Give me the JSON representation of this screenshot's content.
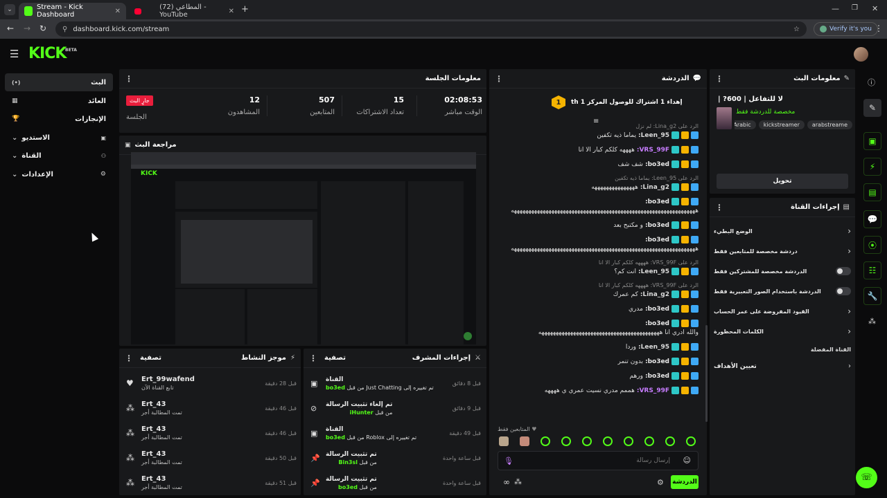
{
  "browser": {
    "tabs": [
      {
        "title": "Stream - Kick Dashboard",
        "active": true
      },
      {
        "title": "(72) المطاعي - YouTube",
        "active": false
      }
    ],
    "url": "dashboard.kick.com/stream",
    "verify_label": "Verify it's you"
  },
  "kick": {
    "logo": "KICK",
    "beta": "BETA"
  },
  "nav": {
    "items": [
      {
        "label": "البث",
        "icon": "(•)"
      },
      {
        "label": "العائد",
        "icon": "▦"
      },
      {
        "label": "الإنجازات",
        "icon": "🏆"
      },
      {
        "label": "الاستديو",
        "icon": "▣"
      },
      {
        "label": "القناة",
        "icon": "⚇"
      },
      {
        "label": "الإعدادات",
        "icon": "⚙"
      }
    ]
  },
  "session": {
    "title": "معلومات الجلسة",
    "live_badge": "جارٍ البث",
    "live_label": "الجلسة",
    "stats": [
      {
        "value": "02:08:53",
        "label": "الوقت مباشر"
      },
      {
        "value": "15",
        "label": "تعداد الاشتراكات"
      },
      {
        "value": "507",
        "label": "المتابعين"
      },
      {
        "value": "12",
        "label": "المشاهدون"
      }
    ]
  },
  "preview": {
    "title": "مراجعة البث"
  },
  "chat": {
    "title": "الدردشة",
    "goal_count": "1",
    "goal_text": "إهداء 1 اشتراك للوصول المركز 1 th",
    "lines": [
      {
        "reply": "الرد على Lina_g2: لم نزل",
        "user": "",
        "text": ""
      },
      {
        "user": "Leen_95:",
        "text": "يماما ذيه تكفين",
        "color": "#dcdcdc"
      },
      {
        "user": "VRS_99F:",
        "text": "ههههه كلكم كبار الا انا",
        "color": "#c77dff"
      },
      {
        "user": "bo3ed:",
        "text": "شف شف",
        "color": "#e8e8e8"
      },
      {
        "reply": "الرد على Leen_95: يماما ذيه تكفين",
        "user": "",
        "text": ""
      },
      {
        "user": "Lina_g2:",
        "text": "هههههههههههههههه",
        "color": "#dcdcdc"
      },
      {
        "user": "bo3ed:",
        "text": "ههههههههههههههههههههههههههههههههههههههههههههههههههههههههههههههههه",
        "color": "#e8e8e8"
      },
      {
        "user": "bo3ed:",
        "text": "و مكتبح بعد",
        "color": "#e8e8e8"
      },
      {
        "user": "bo3ed:",
        "text": "ههههههههههههههههههههههههههههههههههههههههههههههههههههههههههههههههه",
        "color": "#e8e8e8"
      },
      {
        "reply": "الرد على VRS_99F: ههههه كلكم كبار الا انا",
        "user": "",
        "text": ""
      },
      {
        "user": "Leen_95:",
        "text": "انت كم؟",
        "color": "#dcdcdc"
      },
      {
        "reply": "الرد على VRS_99F: ههههه كلكم كبار الا انا",
        "user": "",
        "text": ""
      },
      {
        "user": "Lina_g2:",
        "text": "كم عمرك",
        "color": "#dcdcdc"
      },
      {
        "user": "bo3ed:",
        "text": "مدري",
        "color": "#e8e8e8"
      },
      {
        "user": "bo3ed:",
        "text": "والله ادري انا ههههههههههههههههههههههههههههههههههههههههههه",
        "color": "#e8e8e8"
      },
      {
        "user": "Leen_95:",
        "text": "وردا",
        "color": "#dcdcdc"
      },
      {
        "user": "bo3ed:",
        "text": "بدون تنمر",
        "color": "#e8e8e8"
      },
      {
        "user": "bo3ed:",
        "text": "ورهم",
        "color": "#e8e8e8"
      },
      {
        "user": "VRS_99F:",
        "text": "هممم مدري نسيت عمري ي ههههه",
        "color": "#c77dff"
      }
    ],
    "followers_only": "المتابعين فقط",
    "input_placeholder": "إرسال رسالة",
    "send_label": "الدردشة"
  },
  "stream_info": {
    "title": "معلومات البث",
    "stream_title": "لا للتفاعل | 600? |",
    "category": "مخصصة للدردشة فقط",
    "tags": [
      "arabstreame",
      "kickstreamer",
      "Arabic"
    ],
    "edit_label": "تحويل"
  },
  "channel_actions": {
    "title": "إجراءات القناة",
    "items": [
      {
        "label": "الوضع البطيء",
        "type": "arrow"
      },
      {
        "label": "دردشة مخصصة للمتابعين فقط",
        "type": "arrow"
      },
      {
        "label": "الدردشة مخصصة للمشتركين فقط",
        "type": "toggle"
      },
      {
        "label": "الدردشة باستخدام الصور التعبيرية فقط",
        "type": "toggle"
      },
      {
        "label": "القيود المفروضة على عمر الحساب",
        "type": "arrow"
      },
      {
        "label": "الكلمات المحظورة",
        "type": "arrow"
      }
    ],
    "section_label": "القناة المفضلة",
    "targets_label": "تعيين الأهداف"
  },
  "activity": {
    "title": "موجز النشاط",
    "filter": "تصفية",
    "items": [
      {
        "user": "Ert_99wafend",
        "detail": "تابع القناة الآن",
        "time": "قبل 28 دقيقة",
        "icon": "heart"
      },
      {
        "user": "Ert_43",
        "detail": "تمت المطالبة أجر",
        "time": "قبل 46 دقيقة",
        "icon": "dots"
      },
      {
        "user": "Ert_43",
        "detail": "تمت المطالبة أجر",
        "time": "قبل 46 دقيقة",
        "icon": "dots"
      },
      {
        "user": "Ert_43",
        "detail": "تمت المطالبة أجر",
        "time": "قبل 50 دقيقة",
        "icon": "dots"
      },
      {
        "user": "Ert_43",
        "detail": "تمت المطالبة أجر",
        "time": "قبل 51 دقيقة",
        "icon": "dots"
      }
    ]
  },
  "mod_actions": {
    "title": "إجراءات المشرف",
    "filter": "تصفية",
    "items": [
      {
        "title": "القناة",
        "detail": "تم تغييره إلى Just Chatting من قبل",
        "user": "bo3ed",
        "time": "قبل 8 دقائق",
        "icon": "screen"
      },
      {
        "title": "تم إلغاء تثبيت الرسالة",
        "detail": "من قبل",
        "user": "iHunter",
        "time": "قبل 9 دقائق",
        "icon": "unpin"
      },
      {
        "title": "القناة",
        "detail": "تم تغييره إلى Roblox من قبل",
        "user": "bo3ed",
        "time": "قبل 49 دقيقة",
        "icon": "screen"
      },
      {
        "title": "تم تثبيت الرسالة",
        "detail": "من قبل",
        "user": "Bin3sl",
        "time": "قبل ساعة واحدة",
        "icon": "pin"
      },
      {
        "title": "تم تثبيت الرسالة",
        "detail": "من قبل",
        "user": "bo3ed",
        "time": "قبل ساعة واحدة",
        "icon": "pin"
      }
    ]
  },
  "colors": {
    "accent": "#53fc18",
    "panel": "#18191b",
    "live": "#e91e3c"
  }
}
